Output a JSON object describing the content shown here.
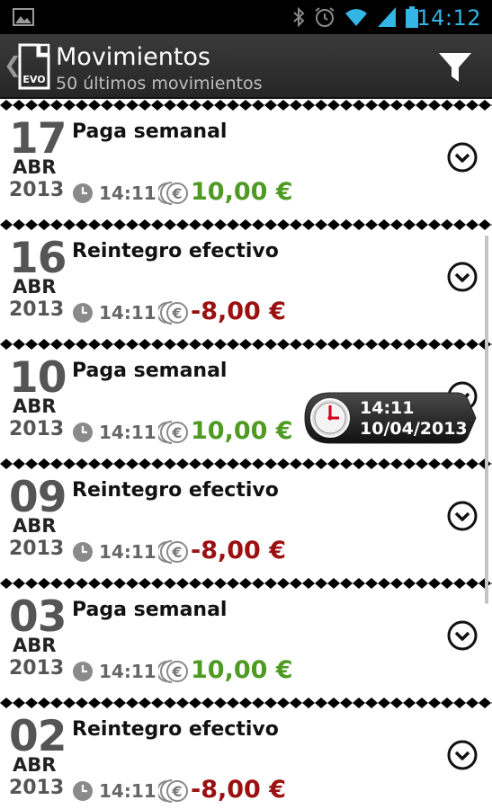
{
  "status_bar": {
    "time": "14:12",
    "icons": [
      "gallery-icon",
      "bluetooth-icon",
      "alarm-icon",
      "wifi-icon",
      "signal-icon",
      "battery-icon"
    ]
  },
  "action_bar": {
    "title": "Movimientos",
    "subtitle": "50 últimos movimientos",
    "app_icon_label": "EVO",
    "filter_icon": "filter-icon"
  },
  "colors": {
    "status_time": "#33b5e5",
    "positive_amount": "#4e9a23",
    "negative_amount": "#9b1010"
  },
  "movements": [
    {
      "day": "17",
      "month": "ABR",
      "year": "2013",
      "description": "Paga semanal",
      "time": "14:11",
      "amount": "10,00 €",
      "sign": "pos"
    },
    {
      "day": "16",
      "month": "ABR",
      "year": "2013",
      "description": "Reintegro efectivo",
      "time": "14:11",
      "amount": "-8,00 €",
      "sign": "neg"
    },
    {
      "day": "10",
      "month": "ABR",
      "year": "2013",
      "description": "Paga semanal",
      "time": "14:11",
      "amount": "10,00 €",
      "sign": "pos"
    },
    {
      "day": "09",
      "month": "ABR",
      "year": "2013",
      "description": "Reintegro efectivo",
      "time": "14:11",
      "amount": "-8,00 €",
      "sign": "neg"
    },
    {
      "day": "03",
      "month": "ABR",
      "year": "2013",
      "description": "Paga semanal",
      "time": "14:11",
      "amount": "10,00 €",
      "sign": "pos"
    },
    {
      "day": "02",
      "month": "ABR",
      "year": "2013",
      "description": "Reintegro efectivo",
      "time": "14:11",
      "amount": "-8,00 €",
      "sign": "neg"
    }
  ],
  "tooltip": {
    "time": "14:11",
    "date": "10/04/2013"
  }
}
